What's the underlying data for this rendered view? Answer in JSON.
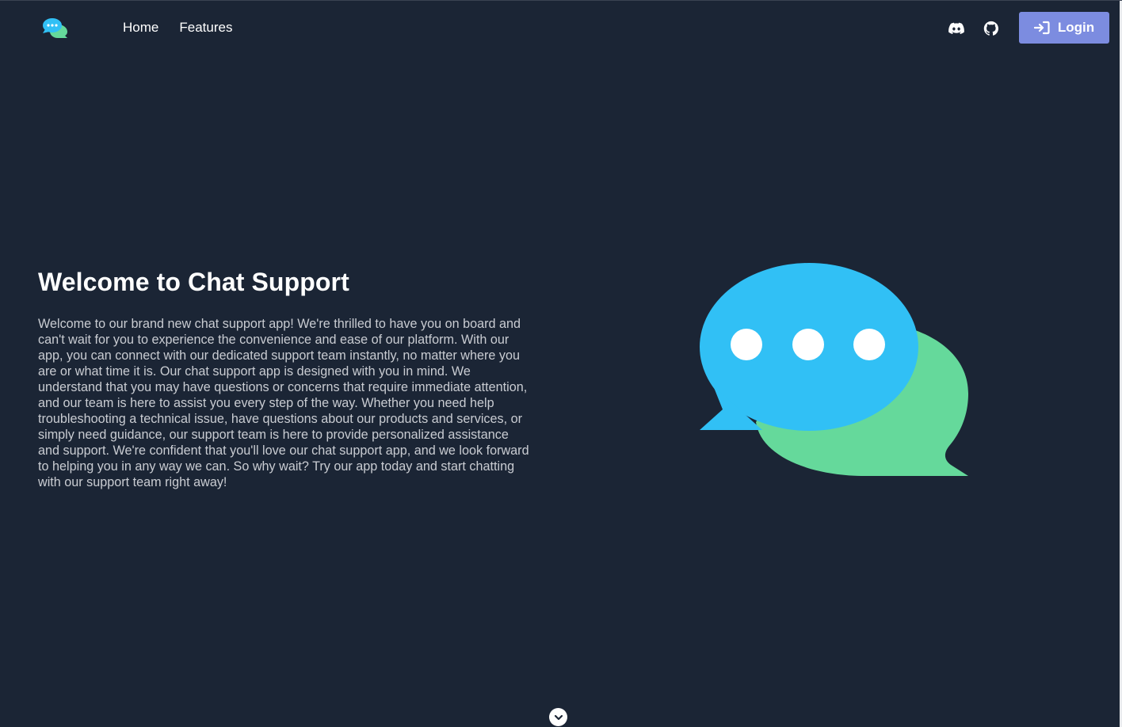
{
  "navbar": {
    "links": [
      {
        "label": "Home"
      },
      {
        "label": "Features"
      }
    ],
    "icons": [
      "discord-icon",
      "github-icon"
    ],
    "login_label": "Login"
  },
  "hero": {
    "title": "Welcome to Chat Support",
    "body": "Welcome to our brand new chat support app! We're thrilled to have you on board and can't wait for you to experience the convenience and ease of our platform. With our app, you can connect with our dedicated support team instantly, no matter where you are or what time it is. Our chat support app is designed with you in mind. We understand that you may have questions or concerns that require immediate attention, and our team is here to assist you every step of the way. Whether you need help troubleshooting a technical issue, have questions about our products and services, or simply need guidance, our support team is here to provide personalized assistance and support. We're confident that you'll love our chat support app, and we look forward to helping you in any way we can. So why wait? Try our app today and start chatting with our support team right away!"
  },
  "colors": {
    "background": "#1b2535",
    "accent": "#7c8ce0",
    "bubble_blue": "#31c0f5",
    "bubble_green": "#65d99b"
  }
}
